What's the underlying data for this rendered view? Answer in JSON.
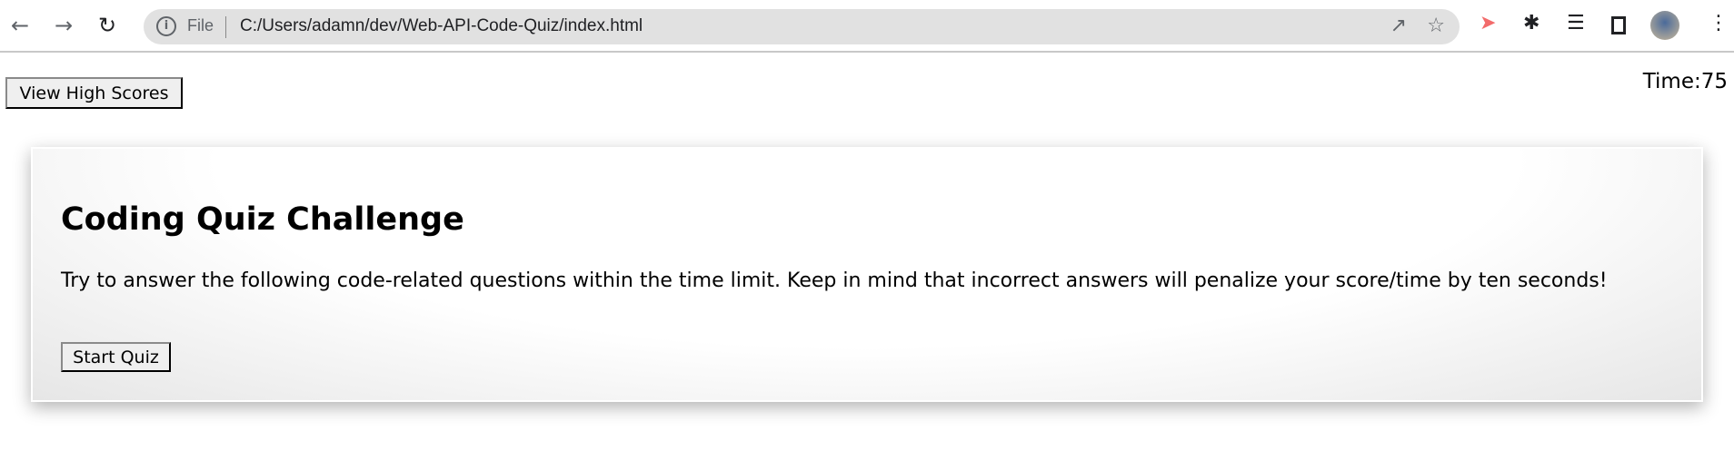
{
  "browser": {
    "file_label": "File",
    "url": "C:/Users/adamn/dev/Web-API-Code-Quiz/index.html",
    "accent": "#e1e1e1"
  },
  "header": {
    "high_scores_label": "View High Scores",
    "timer": "Time:75"
  },
  "card": {
    "title": "Coding Quiz Challenge",
    "description": "Try to answer the following code-related questions within the time limit. Keep in mind that incorrect answers will penalize your score/time by ten seconds!",
    "start_label": "Start Quiz"
  }
}
